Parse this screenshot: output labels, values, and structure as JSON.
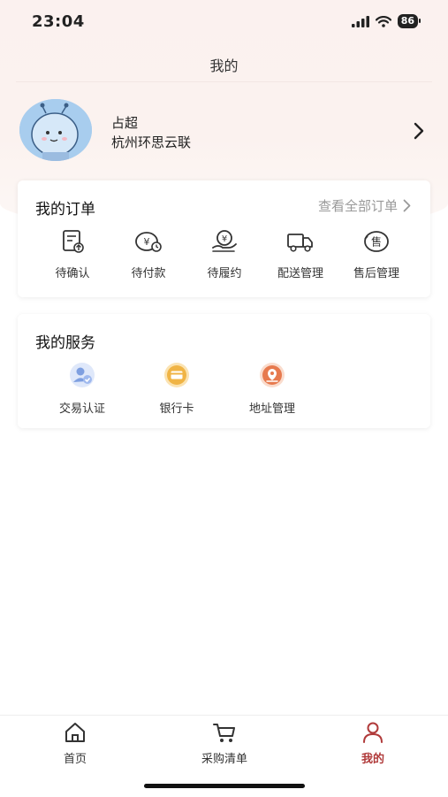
{
  "status_bar": {
    "time": "23:04",
    "battery": "86"
  },
  "nav": {
    "title": "我的"
  },
  "profile": {
    "name": "占超",
    "company": "杭州环思云联"
  },
  "orders": {
    "title": "我的订单",
    "view_all": "查看全部订单",
    "items": [
      {
        "label": "待确认",
        "icon": "document-upload-icon"
      },
      {
        "label": "待付款",
        "icon": "yen-coin-icon"
      },
      {
        "label": "待履约",
        "icon": "yen-hand-icon"
      },
      {
        "label": "配送管理",
        "icon": "truck-icon"
      },
      {
        "label": "售后管理",
        "icon": "after-sale-icon"
      }
    ]
  },
  "services": {
    "title": "我的服务",
    "items": [
      {
        "label": "交易认证",
        "icon": "user-verify-icon",
        "color": "#7e9fe0"
      },
      {
        "label": "银行卡",
        "icon": "bank-card-icon",
        "color": "#f0b445"
      },
      {
        "label": "地址管理",
        "icon": "location-icon",
        "color": "#e77a4e"
      }
    ]
  },
  "tabbar": {
    "items": [
      {
        "label": "首页",
        "icon": "home-icon"
      },
      {
        "label": "采购清单",
        "icon": "cart-icon"
      },
      {
        "label": "我的",
        "icon": "user-icon",
        "active": true
      }
    ]
  },
  "colors": {
    "accent": "#b03a3a",
    "header_bg": "#fbf1ef"
  }
}
